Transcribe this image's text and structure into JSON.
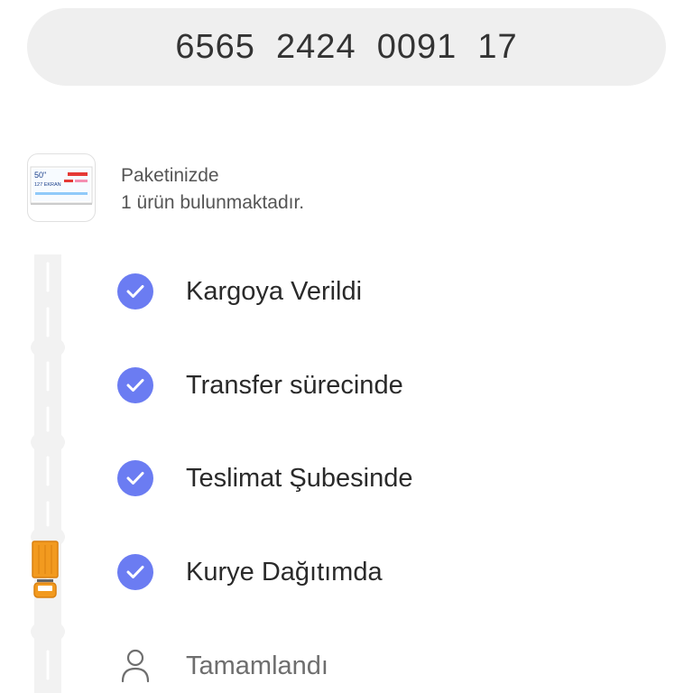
{
  "tracking": {
    "number": "6565  2424  0091  17"
  },
  "package": {
    "title": "Paketinizde",
    "subtitle": "1 ürün bulunmaktadır.",
    "thumbnail_text": {
      "size": "50\"",
      "cm": "127 EKRAN"
    }
  },
  "steps": [
    {
      "label": "Kargoya Verildi",
      "status": "done",
      "icon": "check-icon"
    },
    {
      "label": "Transfer sürecinde",
      "status": "done",
      "icon": "check-icon"
    },
    {
      "label": "Teslimat Şubesinde",
      "status": "done",
      "icon": "check-icon"
    },
    {
      "label": "Kurye Dağıtımda",
      "status": "done",
      "icon": "check-icon"
    },
    {
      "label": "Tamamlandı",
      "status": "pending",
      "icon": "person-icon"
    }
  ],
  "colors": {
    "check": "#6b7cf2",
    "truck": "#f29a1f",
    "road": "#f2f2f2"
  }
}
